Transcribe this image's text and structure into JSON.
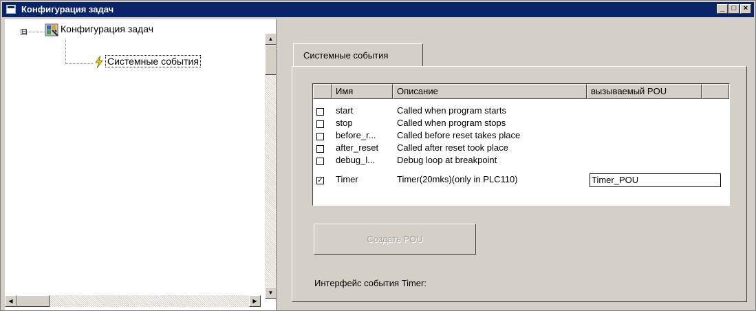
{
  "window": {
    "title": "Конфигурация задач",
    "buttons": {
      "minimize": "_",
      "maximize": "□",
      "close": "×"
    }
  },
  "tree": {
    "root": {
      "expander": "⊟",
      "icon": "task-config-icon",
      "label": "Конфигурация задач"
    },
    "child": {
      "icon": "lightning-icon",
      "label": "Системные события"
    }
  },
  "tab": {
    "label": "Системные события"
  },
  "table": {
    "headers": [
      "Имя",
      "Описание",
      "вызываемый POU"
    ],
    "rows": [
      {
        "checked": false,
        "name": "start",
        "description": "Called when program starts",
        "pou": ""
      },
      {
        "checked": false,
        "name": "stop",
        "description": "Called when program stops",
        "pou": ""
      },
      {
        "checked": false,
        "name": "before_r...",
        "description": "Called before reset takes place",
        "pou": ""
      },
      {
        "checked": false,
        "name": "after_reset",
        "description": "Called after reset took place",
        "pou": ""
      },
      {
        "checked": false,
        "name": "debug_l...",
        "description": "Debug loop at breakpoint",
        "pou": ""
      },
      {
        "checked": true,
        "name": "Timer",
        "description": "Timer(20mks)(only in PLC110)",
        "pou": "Timer_POU"
      }
    ]
  },
  "create_button": {
    "label": "Создать POU",
    "enabled": false
  },
  "interface_label": "Интерфейс события Timer:",
  "colors": {
    "titlebar": "#0a246a",
    "face": "#d4d0c8",
    "disabled_text": "#a0a0a0"
  }
}
